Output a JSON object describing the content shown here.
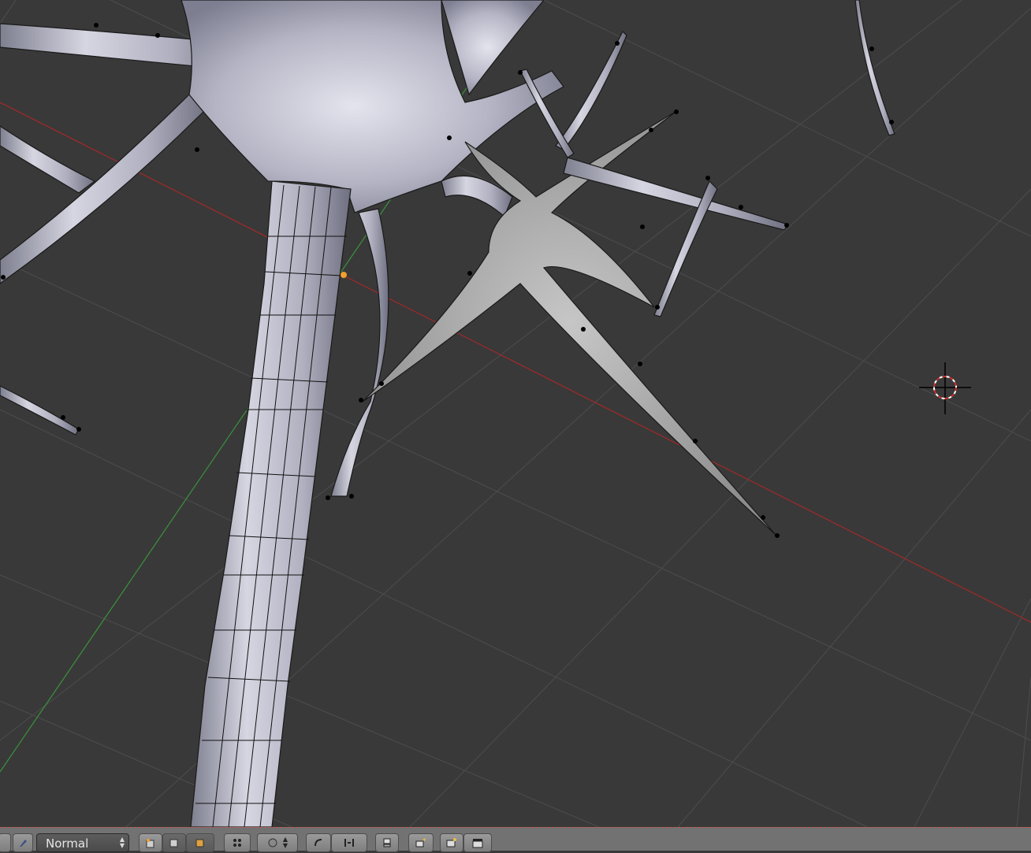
{
  "viewport": {
    "background": "#393939",
    "x_axis_color": "#9b2a2a",
    "y_axis_color": "#3a8c3a",
    "grid_color": "#4d4d4d",
    "mesh_fill": "#b9b9c6",
    "mesh_wire": "#111111",
    "cursor_color": "#d02c2c"
  },
  "header": {
    "background": "#727272",
    "shading_mode": "Normal",
    "icons": [
      "view-mode-icon",
      "vertex-select-icon",
      "edge-select-icon",
      "face-select-icon",
      "occlude-geometry-icon",
      "proportional-edit-icon",
      "snap-icon",
      "snap-target-icon",
      "layers-icon",
      "render-preview-icon",
      "render-animation-icon"
    ]
  }
}
